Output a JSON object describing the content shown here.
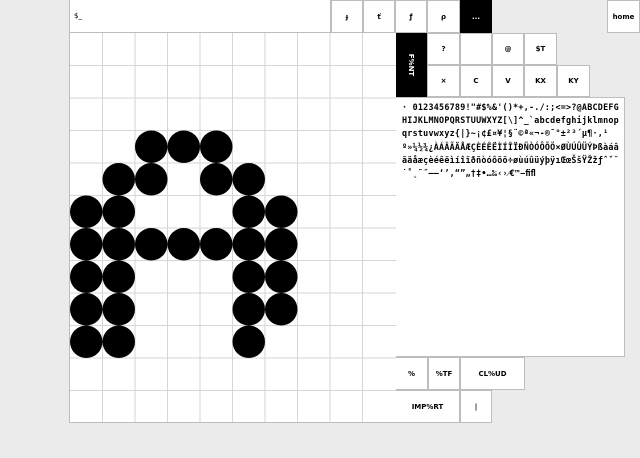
{
  "command": {
    "value": "$_"
  },
  "toolbar": {
    "icons": [
      "ɟ",
      "ť",
      "ƒ",
      "ρ"
    ],
    "more_label": "...",
    "home_label": "home"
  },
  "side_panel": {
    "font_label": "F%NT",
    "row1": [
      "?",
      "@",
      "$T"
    ],
    "row2": [
      "×",
      "C",
      "V",
      "KX",
      "KY"
    ]
  },
  "glyph_set": "· 0123456789!\"#$%&'()*+,-./:;<=>?@ABCDEFGHIJKLMNOPQRSTUUWXYZ[\\]^_`abcdefghijklmnopqrstuvwxyz{|}~¡¢£¤¥¦§¨©ª«¬-®¯°±²³´µ¶·,¹º»¼½¾¿ÀÁÂÃÄÅÆÇÈÉÊËÌÍÎÏÐÑÒÓÔÕÖ×ØÙÚÛÜÝÞßàáâãäåæçèéêëìíîïðñòóôõö÷øùúûüýþÿıŒœŠšŸŽžƒˆˇ˘˙˚˛˜˝–—‘’‚“”„†‡•…‰‹›⁄€™−ﬁﬂ",
  "bottom_panel": {
    "buttons_row1": [
      "%",
      "%TF",
      "CL%UD"
    ],
    "buttons_row2": [
      "IMP%RT",
      "|"
    ]
  },
  "glyph_editor": {
    "columns": 10,
    "rows": 12,
    "filled_cells": [
      [
        2,
        3
      ],
      [
        3,
        3
      ],
      [
        4,
        3
      ],
      [
        1,
        4
      ],
      [
        2,
        4
      ],
      [
        4,
        4
      ],
      [
        5,
        4
      ],
      [
        0,
        5
      ],
      [
        1,
        5
      ],
      [
        5,
        5
      ],
      [
        6,
        5
      ],
      [
        0,
        6
      ],
      [
        1,
        6
      ],
      [
        2,
        6
      ],
      [
        3,
        6
      ],
      [
        4,
        6
      ],
      [
        5,
        6
      ],
      [
        6,
        6
      ],
      [
        0,
        7
      ],
      [
        1,
        7
      ],
      [
        5,
        7
      ],
      [
        6,
        7
      ],
      [
        0,
        8
      ],
      [
        1,
        8
      ],
      [
        5,
        8
      ],
      [
        6,
        8
      ],
      [
        0,
        9
      ],
      [
        1,
        9
      ],
      [
        5,
        9
      ]
    ],
    "dot_color": "#000000",
    "grid_color": "#d6d6d6"
  }
}
